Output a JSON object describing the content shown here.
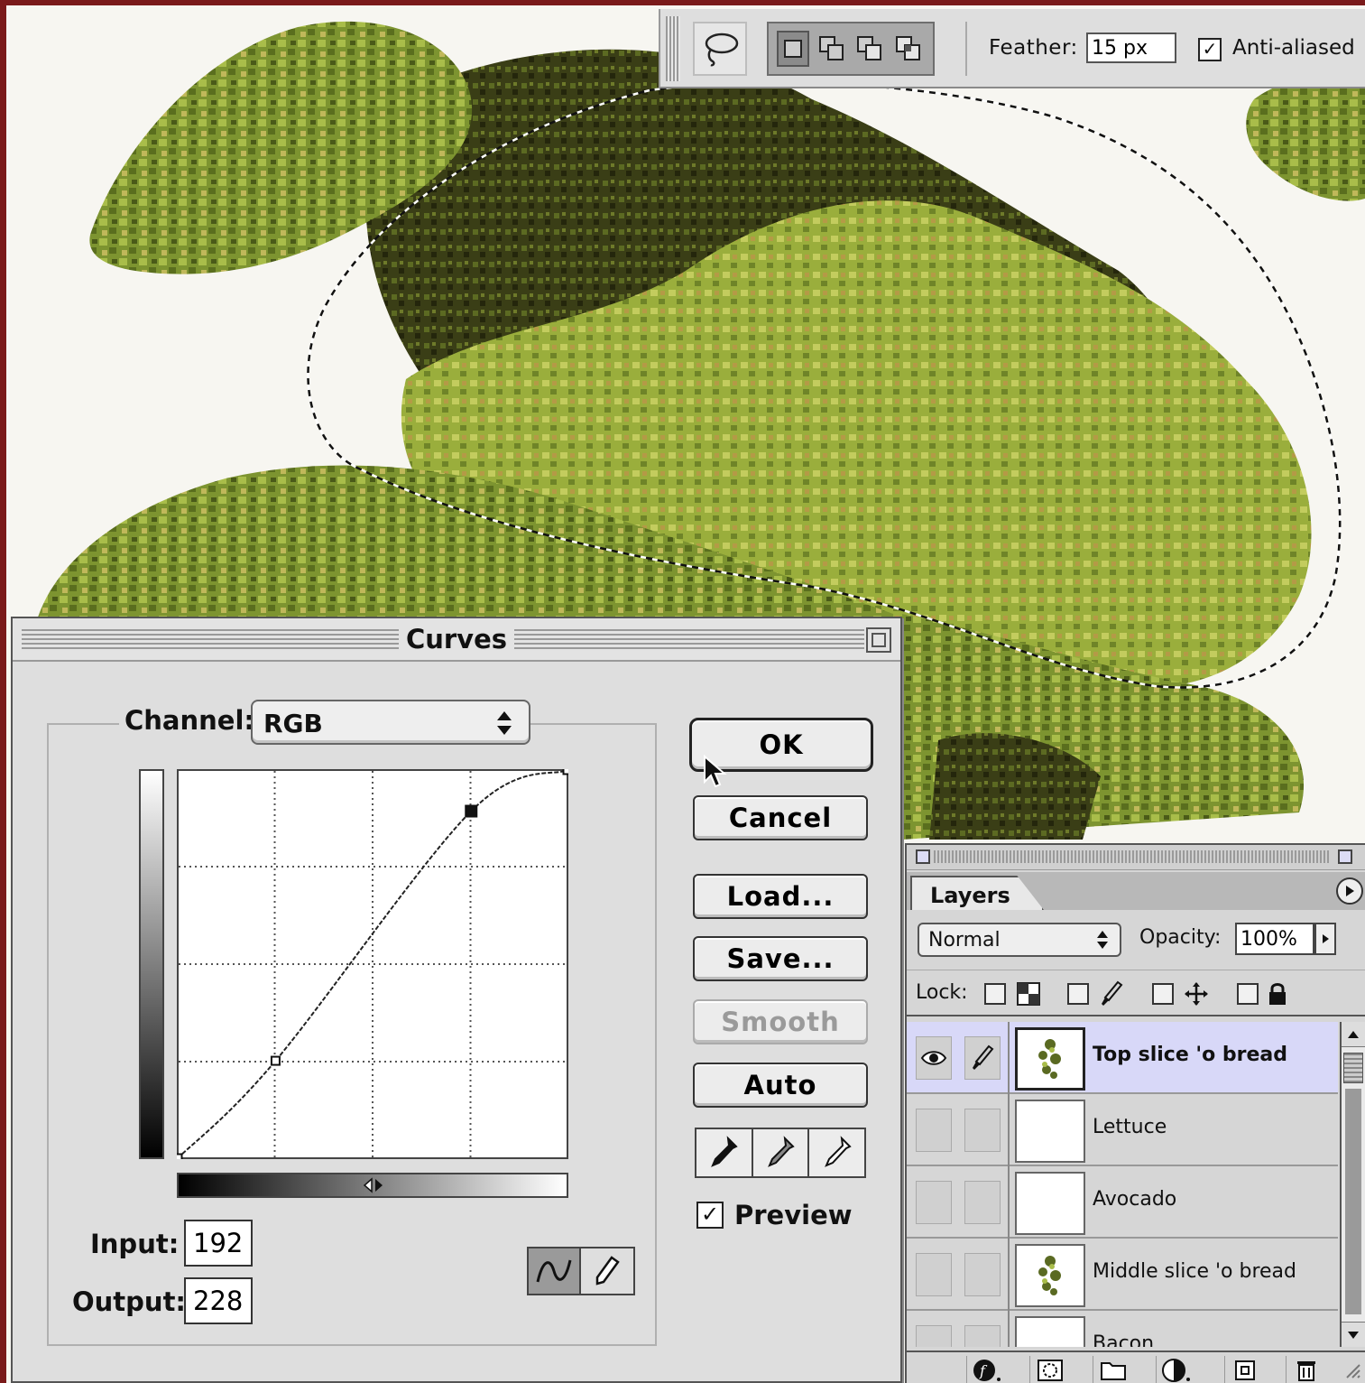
{
  "options_bar": {
    "tool": "lasso-icon",
    "selection_modes": [
      "new-selection-icon",
      "add-to-selection-icon",
      "subtract-from-selection-icon",
      "intersect-selection-icon"
    ],
    "feather_label": "Feather:",
    "feather_value": "15 px",
    "antialiased_label": "Anti-aliased",
    "antialiased_checked": true
  },
  "curves": {
    "title": "Curves",
    "channel_label": "Channel:",
    "channel_value": "RGB",
    "input_label": "Input:",
    "input_value": "192",
    "output_label": "Output:",
    "output_value": "228",
    "buttons": {
      "ok": "OK",
      "cancel": "Cancel",
      "load": "Load...",
      "save": "Save...",
      "smooth": "Smooth",
      "auto": "Auto"
    },
    "preview_label": "Preview",
    "preview_checked": true,
    "curve_points": [
      [
        0,
        0
      ],
      [
        64,
        64
      ],
      [
        192,
        228
      ],
      [
        255,
        255
      ]
    ]
  },
  "layers": {
    "tab": "Layers",
    "blend_mode": "Normal",
    "opacity_label": "Opacity:",
    "opacity_value": "100%",
    "lock_label": "Lock:",
    "items": [
      {
        "name": "Top slice 'o bread",
        "selected": true,
        "visible": true
      },
      {
        "name": "Lettuce",
        "selected": false,
        "visible": false
      },
      {
        "name": "Avocado",
        "selected": false,
        "visible": false
      },
      {
        "name": "Middle slice 'o bread",
        "selected": false,
        "visible": false
      },
      {
        "name": "Bacon",
        "selected": false,
        "visible": false
      }
    ]
  },
  "colors": {
    "foliage_light": "#a4b844",
    "foliage_dark": "#2a2c10",
    "frame": "#7a1a1a",
    "selected_layer": "#d8d8f8"
  }
}
